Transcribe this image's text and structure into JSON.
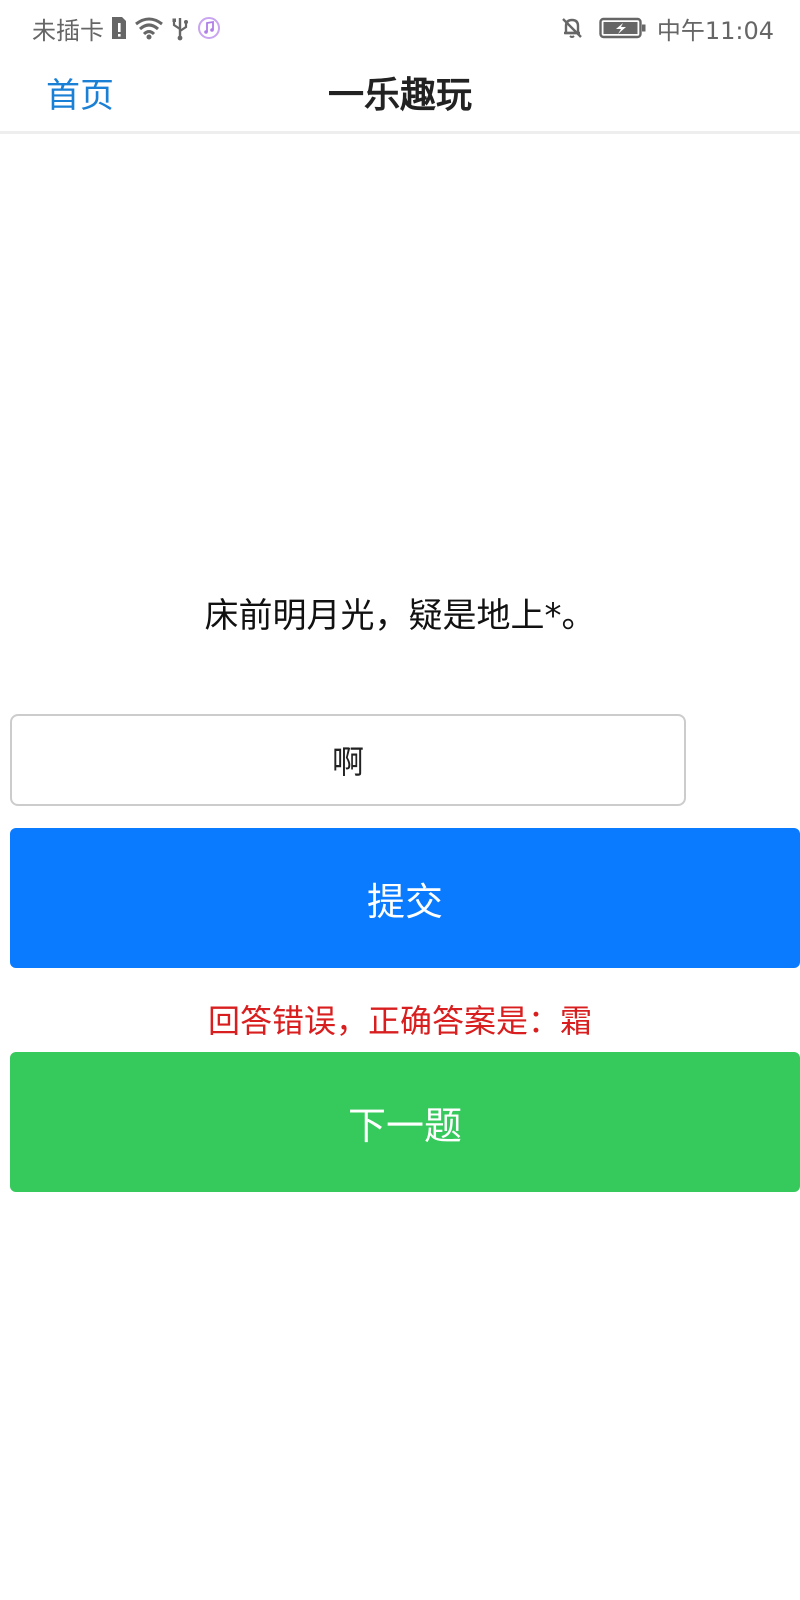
{
  "status_bar": {
    "carrier": "未插卡",
    "time": "中午11:04"
  },
  "nav": {
    "back_label": "首页",
    "title": "一乐趣玩"
  },
  "question": {
    "text": "床前明月光，疑是地上*。"
  },
  "answer_input": {
    "value": "啊"
  },
  "buttons": {
    "submit_label": "提交",
    "next_label": "下一题"
  },
  "feedback": {
    "text": "回答错误，正确答案是：霜"
  },
  "colors": {
    "link": "#1a80d6",
    "submit": "#0a7bff",
    "next": "#36c95c",
    "error": "#d81e1e"
  }
}
